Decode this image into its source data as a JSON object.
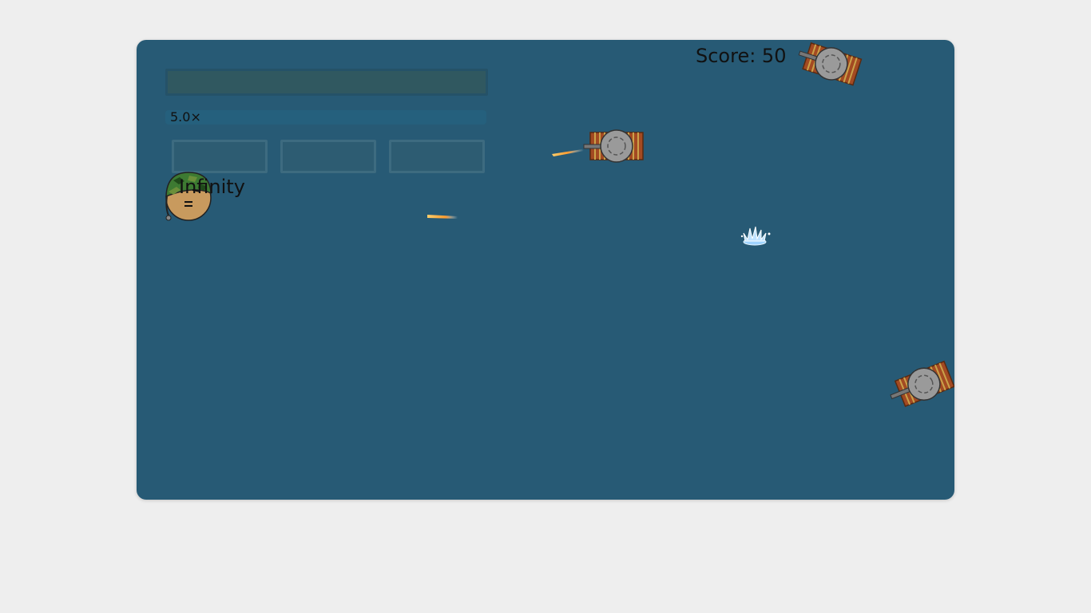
{
  "hud": {
    "score_label": "Score: 50",
    "multiplier": "5.0×",
    "ammo": "Infinity",
    "upgrade_buttons": [
      {
        "label": ""
      },
      {
        "label": ""
      },
      {
        "label": ""
      }
    ]
  },
  "entities": {
    "player": "soldier-helmet-icon",
    "enemies": [
      "tank-icon",
      "tank-icon",
      "tank-icon"
    ],
    "projectiles": [
      "bullet-icon",
      "bullet-icon"
    ],
    "effects": [
      "water-splash-icon"
    ]
  },
  "colors": {
    "page_background": "#eeeeee",
    "board_background": "#275a75",
    "hud_bar": "#305860",
    "multiplier_track": "#25607d",
    "button_fill": "#2d5c72",
    "tank_track": "#a34a22",
    "tank_turret": "#9a9a9a"
  }
}
